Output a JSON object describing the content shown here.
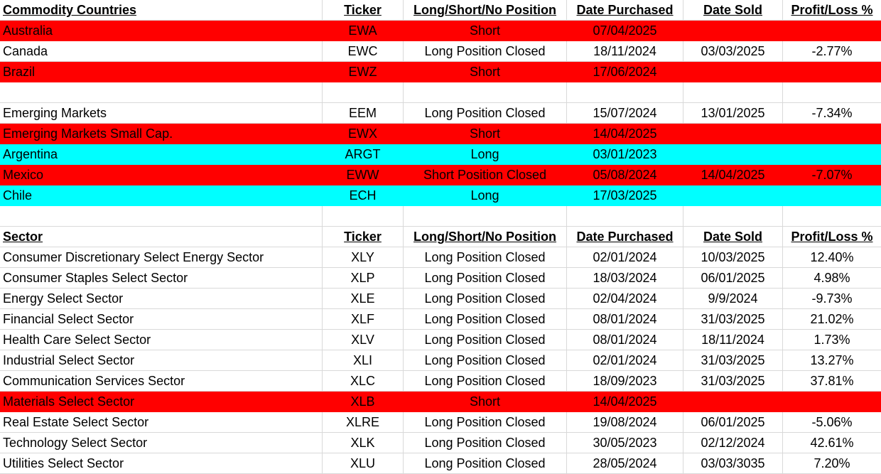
{
  "colors": {
    "short": "#ff0000",
    "long": "#00ffff",
    "grid": "#d9d9d9"
  },
  "commodity": {
    "headers": [
      "Commodity Countries",
      "Ticker",
      "Long/Short/No Position",
      "Date Purchased",
      "Date Sold",
      "Profit/Loss %"
    ],
    "rows_a": [
      {
        "cells": [
          "Australia",
          "EWA",
          "Short",
          "07/04/2025",
          "",
          ""
        ],
        "color": "short"
      },
      {
        "cells": [
          "Canada",
          "EWC",
          "Long Position Closed",
          "18/11/2024",
          "03/03/2025",
          "-2.77%"
        ],
        "color": "none"
      },
      {
        "cells": [
          "Brazil",
          "EWZ",
          "Short",
          "17/06/2024",
          "",
          ""
        ],
        "color": "short"
      }
    ],
    "rows_b": [
      {
        "cells": [
          "Emerging Markets",
          "EEM",
          "Long Position Closed",
          "15/07/2024",
          "13/01/2025",
          "-7.34%"
        ],
        "color": "none"
      },
      {
        "cells": [
          "Emerging Markets Small Cap.",
          "EWX",
          "Short",
          "14/04/2025",
          "",
          ""
        ],
        "color": "short"
      },
      {
        "cells": [
          "Argentina",
          "ARGT",
          "Long",
          "03/01/2023",
          "",
          ""
        ],
        "color": "long"
      },
      {
        "cells": [
          "Mexico",
          "EWW",
          "Short Position Closed",
          "05/08/2024",
          "14/04/2025",
          "-7.07%"
        ],
        "color": "short"
      },
      {
        "cells": [
          "Chile",
          "ECH",
          "Long",
          "17/03/2025",
          "",
          ""
        ],
        "color": "long"
      }
    ]
  },
  "sector": {
    "headers": [
      "Sector",
      "Ticker",
      "Long/Short/No Position",
      "Date Purchased",
      "Date Sold",
      "Profit/Loss %"
    ],
    "rows": [
      {
        "cells": [
          "Consumer Discretionary Select Energy Sector",
          "XLY",
          "Long Position Closed",
          "02/01/2024",
          "10/03/2025",
          "12.40%"
        ],
        "color": "none"
      },
      {
        "cells": [
          "Consumer Staples Select Sector",
          "XLP",
          "Long Position Closed",
          "18/03/2024",
          "06/01/2025",
          "4.98%"
        ],
        "color": "none"
      },
      {
        "cells": [
          "Energy Select Sector",
          "XLE",
          "Long Position Closed",
          "02/04/2024",
          "9/9/2024",
          "-9.73%"
        ],
        "color": "none"
      },
      {
        "cells": [
          "Financial Select Sector",
          "XLF",
          "Long Position Closed",
          "08/01/2024",
          "31/03/2025",
          "21.02%"
        ],
        "color": "none"
      },
      {
        "cells": [
          "Health Care Select Sector",
          "XLV",
          "Long Position Closed",
          "08/01/2024",
          "18/11/2024",
          "1.73%"
        ],
        "color": "none"
      },
      {
        "cells": [
          "Industrial Select Sector",
          "XLI",
          "Long Position Closed",
          "02/01/2024",
          "31/03/2025",
          "13.27%"
        ],
        "color": "none"
      },
      {
        "cells": [
          "Communication Services Sector",
          "XLC",
          "Long Position Closed",
          "18/09/2023",
          "31/03/2025",
          "37.81%"
        ],
        "color": "none"
      },
      {
        "cells": [
          "Materials Select Sector",
          "XLB",
          "Short",
          "14/04/2025",
          "",
          ""
        ],
        "color": "short"
      },
      {
        "cells": [
          "Real Estate Select Sector",
          "XLRE",
          "Long Position Closed",
          "19/08/2024",
          "06/01/2025",
          "-5.06%"
        ],
        "color": "none"
      },
      {
        "cells": [
          "Technology Select Sector",
          "XLK",
          "Long Position Closed",
          "30/05/2023",
          "02/12/2024",
          "42.61%"
        ],
        "color": "none"
      },
      {
        "cells": [
          "Utilities Select Sector",
          "XLU",
          "Long Position Closed",
          "28/05/2024",
          "03/03/3035",
          "7.20%"
        ],
        "color": "none"
      }
    ]
  }
}
